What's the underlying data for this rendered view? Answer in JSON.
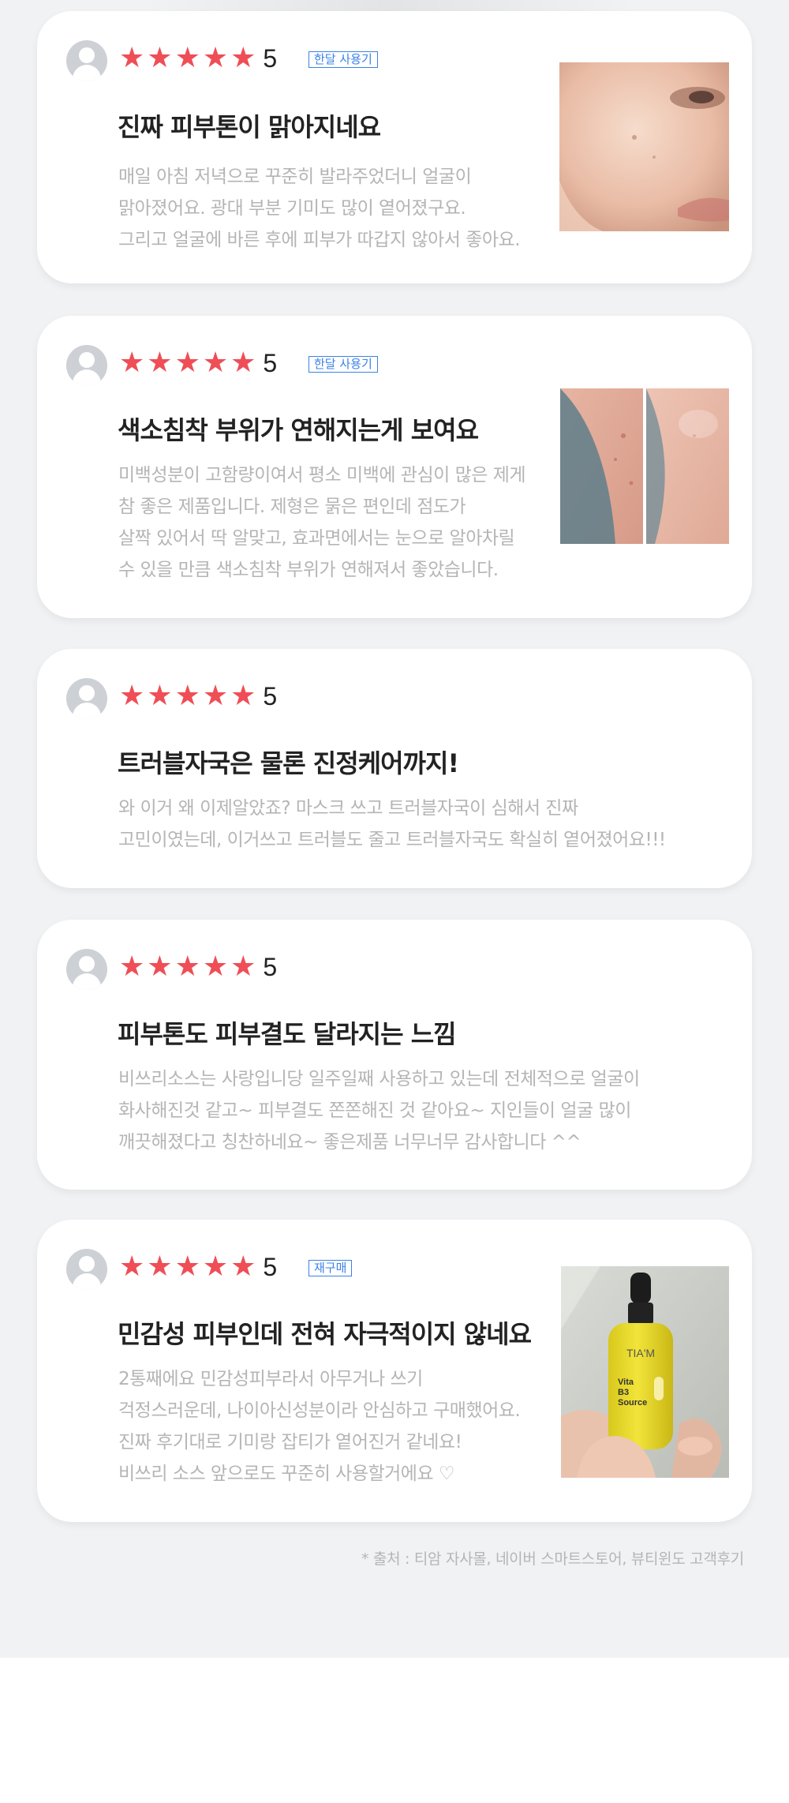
{
  "reviews": [
    {
      "rating": "5",
      "tag": "한달 사용기",
      "title": "진짜 피부톤이 맑아지네요",
      "lines": [
        "매일 아침 저녁으로 꾸준히 발라주었더니 얼굴이",
        "맑아졌어요. 광대 부분 기미도 많이 옅어졌구요.",
        "그리고 얼굴에 바른 후에 피부가 따갑지 않아서 좋아요."
      ]
    },
    {
      "rating": "5",
      "tag": "한달 사용기",
      "title": "색소침착 부위가 연해지는게 보여요",
      "lines": [
        "미백성분이 고함량이여서 평소 미백에 관심이 많은 제게",
        "참 좋은 제품입니다. 제형은 묽은 편인데 점도가",
        "살짝 있어서 딱 알맞고, 효과면에서는 눈으로 알아차릴",
        "수 있을 만큼 색소침착 부위가 연해져서 좋았습니다."
      ]
    },
    {
      "rating": "5",
      "title": "트러블자국은 물론 진정케어까지!",
      "lines": [
        "와 이거 왜 이제알았죠? 마스크 쓰고 트러블자국이 심해서 진짜",
        "고민이였는데, 이거쓰고 트러블도 줄고 트러블자국도 확실히 옅어졌어요!!!"
      ]
    },
    {
      "rating": "5",
      "title": "피부톤도 피부결도 달라지는 느낌",
      "lines": [
        "비쓰리소스는 사랑입니당 일주일째 사용하고 있는데 전체적으로 얼굴이",
        "화사해진것 같고~ 피부결도 쫀쫀해진 것 같아요~ 지인들이 얼굴 많이",
        "깨끗해졌다고 칭찬하네요~ 좋은제품 너무너무 감사합니다 ^^"
      ]
    },
    {
      "rating": "5",
      "tag": "재구매",
      "title": "민감성 피부인데 전혀 자극적이지 않네요",
      "lines": [
        "2통째에요 민감성피부라서 아무거나 쓰기",
        "걱정스러운데, 나이아신성분이라 안심하고 구매했어요.",
        "진짜 후기대로 기미랑 잡티가 옅어진거 같네요!",
        "비쓰리 소스 앞으로도 꾸준히 사용할거에요 ♡"
      ],
      "bottle_label": {
        "brand": "TIA'M",
        "name_1": "Vita",
        "name_2": "B3",
        "name_3": "Source"
      }
    }
  ],
  "footnote": "* 출처 : 티암 자사몰, 네이버 스마트스토어, 뷰티윈도 고객후기",
  "colors": {
    "star": "#ef4e56",
    "tag": "#3b82e6",
    "panel_bg": "#f1f2f4"
  },
  "icons": {
    "star": "★",
    "avatar": "user-avatar-icon"
  }
}
